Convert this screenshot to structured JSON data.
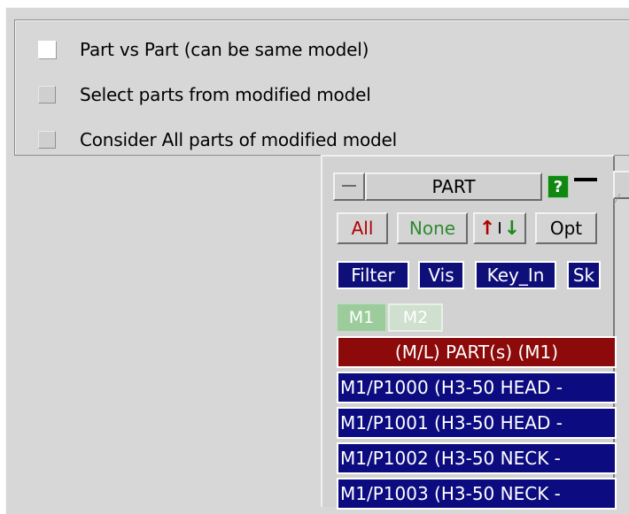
{
  "options": [
    {
      "label": "Part vs Part (can be same model)",
      "checked": true
    },
    {
      "label": "Select parts from modified model",
      "checked": false
    },
    {
      "label": "Consider All parts of modified model",
      "checked": false
    }
  ],
  "part_window": {
    "title": "PART",
    "help_label": "?",
    "buttons": {
      "all": "All",
      "none": "None",
      "sort_up": "↑",
      "sort_sep": "I",
      "sort_down": "↓",
      "opt": "Opt"
    },
    "filters": {
      "filter": "Filter",
      "vis": "Vis",
      "key_in": "Key_In",
      "sk": "Sk"
    },
    "model_tabs": [
      "M1",
      "M2"
    ],
    "list_header": "(M/L) PART(s) (M1)",
    "items": [
      "M1/P1000 (H3-50 HEAD -",
      "M1/P1001 (H3-50 HEAD -",
      "M1/P1002 (H3-50 NECK -",
      "M1/P1003 (H3-50 NECK -"
    ]
  },
  "colors": {
    "panel_bg": "#d7d7d7",
    "list_item_bg": "#0c0c80",
    "list_header_bg": "#8c0a0a",
    "help_bg": "#118811",
    "all_text": "#b00000",
    "none_text": "#2e8b2e"
  }
}
